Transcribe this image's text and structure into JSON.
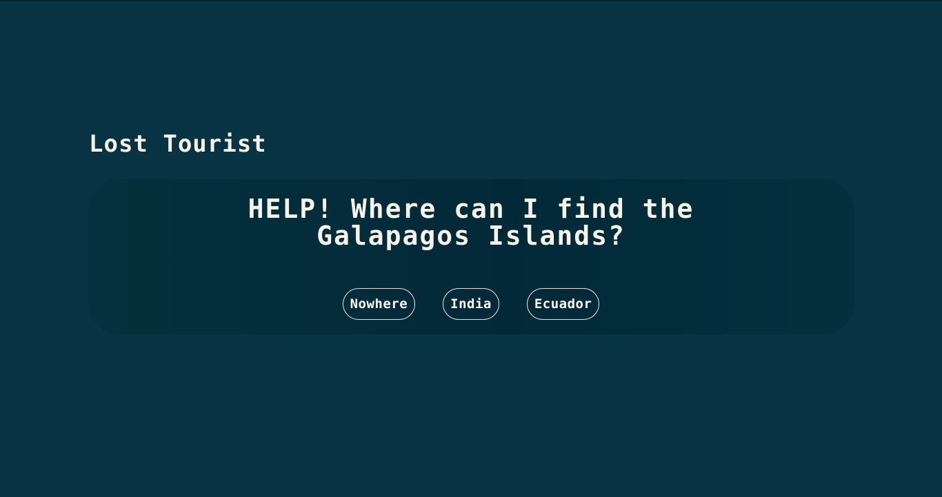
{
  "app": {
    "title": "Lost Tourist"
  },
  "quiz": {
    "question_line1": "HELP! Where can I find the",
    "question_line2": "Galapagos Islands?",
    "answers": [
      "Nowhere",
      "India",
      "Ecuador"
    ]
  },
  "colors": {
    "background": "#073342",
    "card": "#022938",
    "text": "#f6f3e8",
    "button_border": "#e6e2d6"
  }
}
